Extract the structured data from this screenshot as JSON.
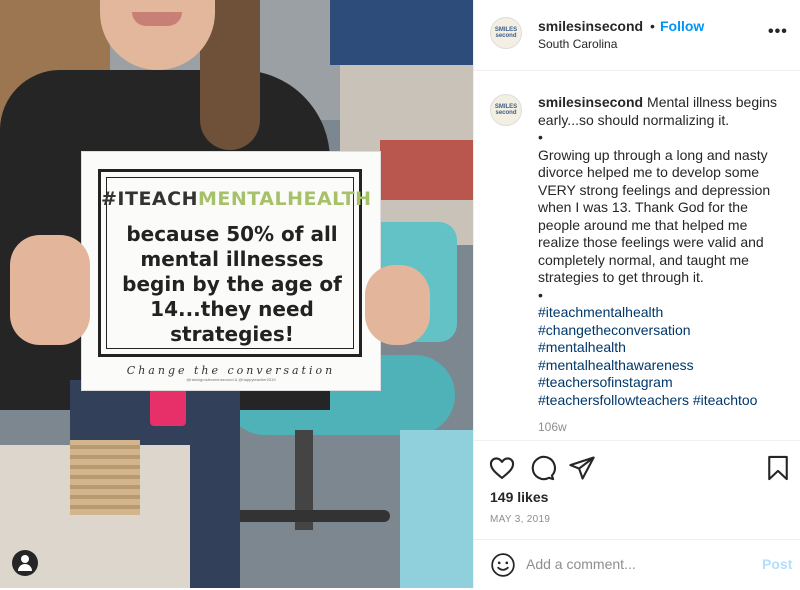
{
  "post": {
    "username": "smilesinsecond",
    "follow_separator": "•",
    "follow_label": "Follow",
    "location": "South Carolina",
    "more_label": "•••",
    "avatar_text": "SMILES second"
  },
  "caption": {
    "username": "smilesinsecond",
    "intro": "Mental illness begins early...so should normalizing it.",
    "bullet": "•",
    "story": "Growing up through a long and nasty divorce helped me to develop some VERY strong feelings and depression when I was 13. Thank God for the people around me that helped me realize those feelings were valid and completely normal, and taught me strategies to get through it.",
    "hashtags": [
      "#iteachmentalhealth",
      "#changetheconversation",
      "#mentalhealth",
      "#mentalhealthawareness",
      "#teachersofinstagram",
      "#teachersfollowteachers #iteachtoo"
    ],
    "time_ago": "106w"
  },
  "actions": {
    "icons": [
      "heart-icon",
      "comment-icon",
      "share-icon",
      "bookmark-icon"
    ],
    "likes": "149 likes",
    "date": "MAY 3, 2019"
  },
  "comment": {
    "placeholder": "Add a comment...",
    "post_label": "Post"
  },
  "sign": {
    "hashtag_dark": "#ITEACH",
    "hashtag_green": "MENTALHEALTH",
    "text": "because 50% of all mental illnesses begin by the age of 14...they need strategies!",
    "footer": "Change the conversation",
    "credit": "@raisingrosiesmensecond & @happyteacher2019"
  },
  "colors": {
    "accent": "#0095f6",
    "hashtag_link": "#00376b",
    "sign_green": "#a6c16a",
    "chair": "#62c2c6"
  }
}
